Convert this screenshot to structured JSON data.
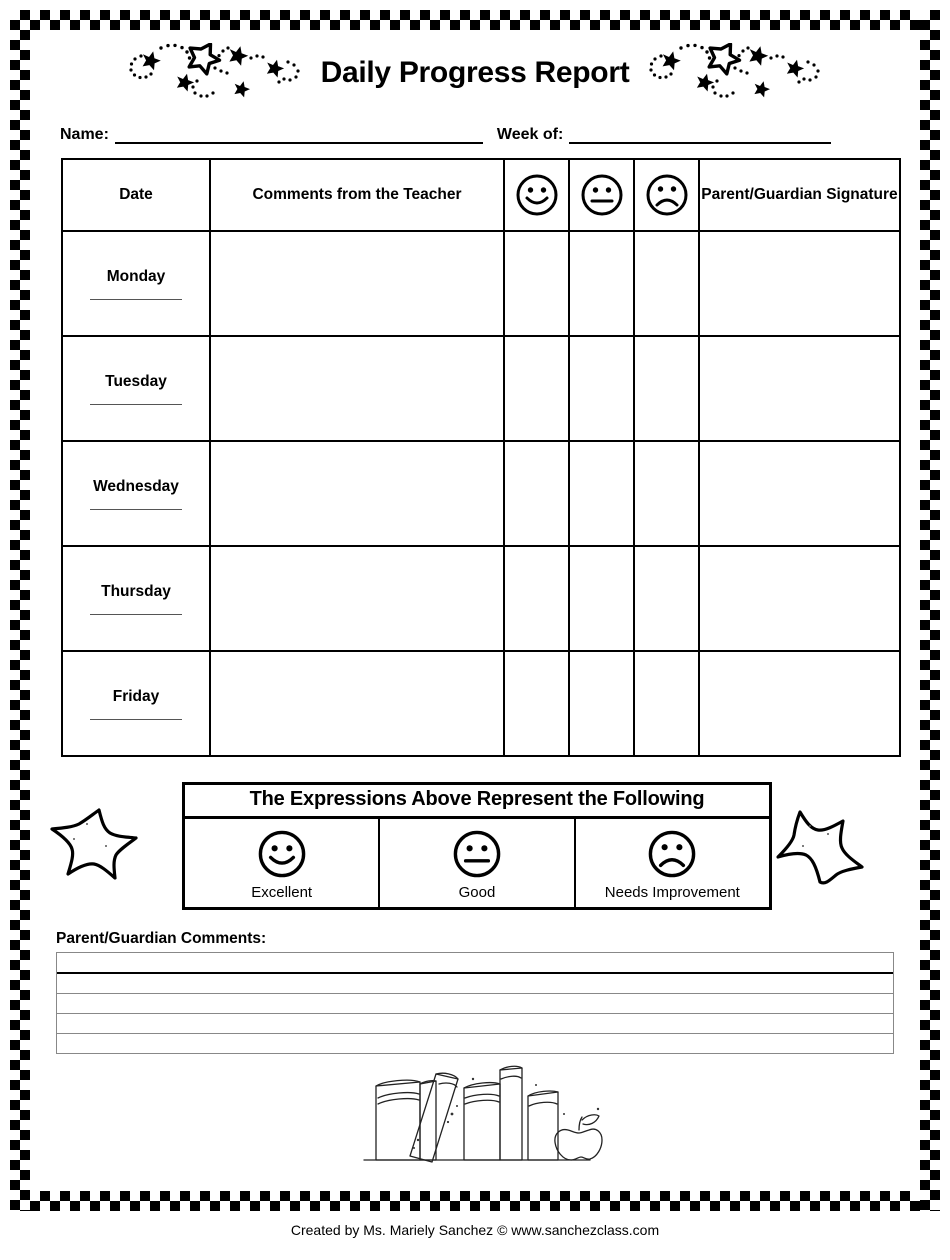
{
  "document": {
    "title": "Daily Progress Report"
  },
  "fields": {
    "name_label": "Name:",
    "week_label": "Week of:",
    "name_value": "",
    "week_value": ""
  },
  "table": {
    "headers": {
      "date": "Date",
      "comments": "Comments from the Teacher",
      "face_happy": "happy-face-icon",
      "face_neutral": "neutral-face-icon",
      "face_sad": "sad-face-icon",
      "signature": "Parent/Guardian Signature"
    },
    "rows": [
      {
        "day": "Monday",
        "date_value": "",
        "comment_value": "",
        "signature_value": ""
      },
      {
        "day": "Tuesday",
        "date_value": "",
        "comment_value": "",
        "signature_value": ""
      },
      {
        "day": "Wednesday",
        "date_value": "",
        "comment_value": "",
        "signature_value": ""
      },
      {
        "day": "Thursday",
        "date_value": "",
        "comment_value": "",
        "signature_value": ""
      },
      {
        "day": "Friday",
        "date_value": "",
        "comment_value": "",
        "signature_value": ""
      }
    ]
  },
  "legend": {
    "title": "The Expressions Above Represent the Following",
    "items": [
      {
        "icon": "happy-face-icon",
        "label": "Excellent"
      },
      {
        "icon": "neutral-face-icon",
        "label": "Good"
      },
      {
        "icon": "sad-face-icon",
        "label": "Needs Improvement"
      }
    ]
  },
  "comments_section": {
    "heading": "Parent/Guardian Comments:",
    "line_count": 5,
    "lines": [
      "",
      "",
      "",
      "",
      ""
    ]
  },
  "decorations": {
    "header_stars_left": "stars-swirl-decoration",
    "header_stars_right": "stars-swirl-decoration",
    "star_left": "star-icon",
    "star_right": "star-icon",
    "books": "books-and-apple-illustration",
    "border": "checkerboard-border"
  },
  "footer": {
    "credit": "Created by Ms. Mariely Sanchez © www.sanchezclass.com"
  },
  "colors": {
    "ink": "#000000",
    "paper": "#ffffff",
    "rule_gray": "#888888"
  }
}
